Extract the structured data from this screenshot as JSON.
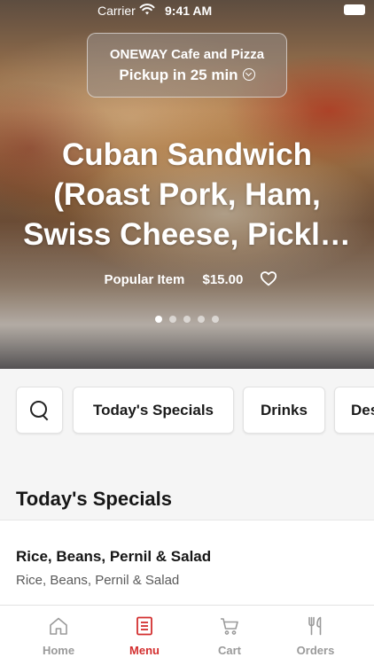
{
  "status_bar": {
    "carrier": "Carrier",
    "time": "9:41 AM"
  },
  "store": {
    "name": "ONEWAY Cafe and Pizza",
    "pickup": "Pickup in 25 min"
  },
  "hero": {
    "title": "Cuban Sandwich (Roast Pork, Ham, Swiss Cheese, Pickl…",
    "tag": "Popular Item",
    "price": "$15.00",
    "carousel": {
      "count": 5,
      "active": 1
    }
  },
  "categories": [
    "Today's Specials",
    "Drinks",
    "Desserts"
  ],
  "section": {
    "title": "Today's Specials"
  },
  "items": [
    {
      "name": "Rice, Beans, Pernil & Salad",
      "description": "Rice, Beans, Pernil & Salad"
    }
  ],
  "tabs": [
    {
      "label": "Home",
      "icon": "home-icon"
    },
    {
      "label": "Menu",
      "icon": "menu-icon",
      "active": true
    },
    {
      "label": "Cart",
      "icon": "cart-icon"
    },
    {
      "label": "Orders",
      "icon": "fork-knife-icon"
    }
  ],
  "colors": {
    "accent": "#d32f2f",
    "inactive_tab": "#9a9a9a"
  }
}
